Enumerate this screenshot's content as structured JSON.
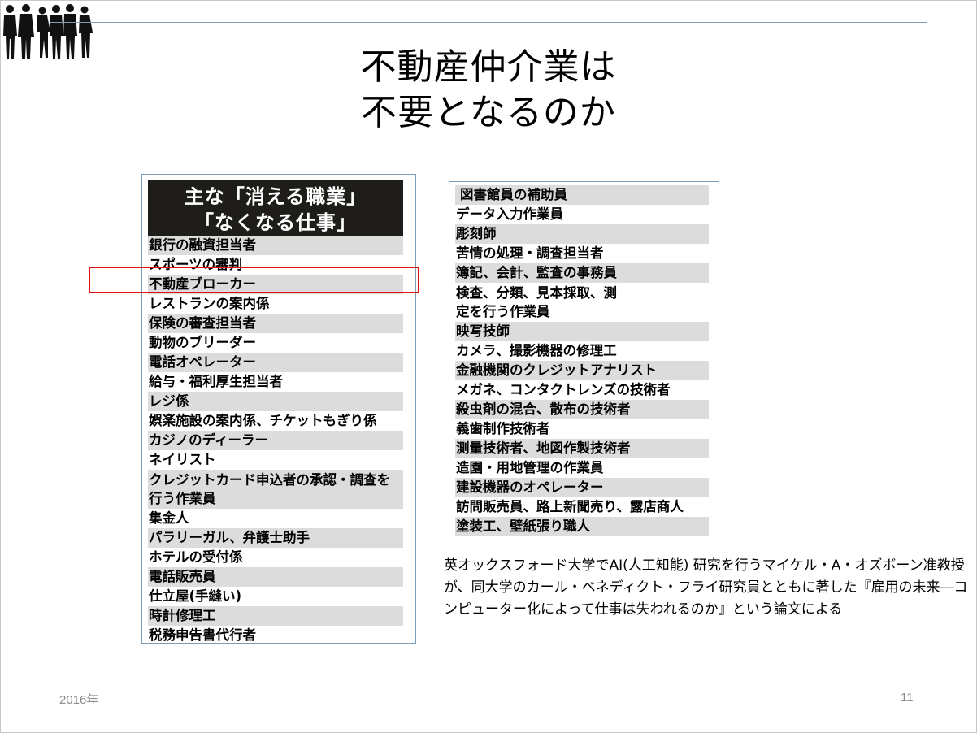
{
  "slide": {
    "title_lines": [
      "不動産仲介業は",
      "不要となるのか"
    ],
    "footer_date": "2016年",
    "page_number": "11",
    "note": "英オックスフォード大学でAI(人工知能) 研究を行うマイケル・A・オズボーン准教授が、同大学のカール・ベネディクト・フライ研究員とともに著した『雇用の未来―コンピューター化によって仕事は失われるのか』という論文による"
  },
  "left_panel": {
    "header_lines": [
      "主な「消える職業」",
      "「なくなる仕事」"
    ],
    "jobs": [
      "銀行の融資担当者",
      "スポーツの審判",
      "不動産ブローカー",
      "レストランの案内係",
      "保険の審査担当者",
      "動物のブリーダー",
      "電話オペレーター",
      "給与・福利厚生担当者",
      "レジ係",
      "娯楽施設の案内係、チケットもぎり係",
      "カジノのディーラー",
      "ネイリスト",
      "クレジットカード申込者の承認・調査を行う作業員",
      "集金人",
      "パラリーガル、弁護士助手",
      "ホテルの受付係",
      "電話販売員",
      "仕立屋(手縫い)",
      "時計修理工",
      "税務申告書代行者"
    ]
  },
  "right_panel": {
    "jobs": [
      "図書館員の補助員",
      "データ入力作業員",
      "彫刻師",
      "苦情の処理・調査担当者",
      "簿記、会計、監査の事務員",
      "検査、分類、見本採取、測定を行う作業員",
      "映写技師",
      "カメラ、撮影機器の修理工",
      "金融機関のクレジットアナリスト",
      "メガネ、コンタクトレンズの技術者",
      "殺虫剤の混合、散布の技術者",
      "義歯制作技術者",
      "測量技術者、地図作製技術者",
      "造園・用地管理の作業員",
      "建設機器のオペレーター",
      "訪問販売員、路上新聞売り、露店商人",
      "塗装工、壁紙張り職人"
    ]
  },
  "colors": {
    "highlight": "#e01010",
    "row_shade": "#dcdcdc",
    "header_bg": "#1f1d19",
    "frame": "#7a9cb8"
  },
  "icons": {
    "corner_graphic": "business-people-silhouettes-icon"
  }
}
